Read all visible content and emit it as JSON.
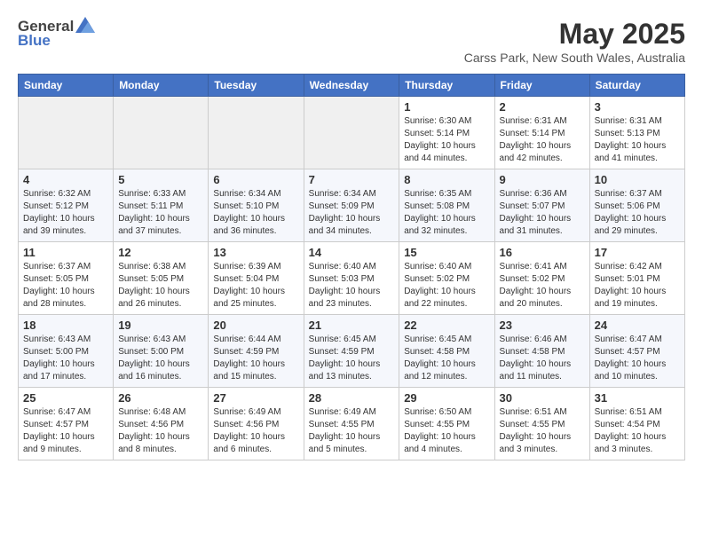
{
  "header": {
    "logo_general": "General",
    "logo_blue": "Blue",
    "month_title": "May 2025",
    "subtitle": "Carss Park, New South Wales, Australia"
  },
  "days_of_week": [
    "Sunday",
    "Monday",
    "Tuesday",
    "Wednesday",
    "Thursday",
    "Friday",
    "Saturday"
  ],
  "weeks": [
    [
      {
        "day": "",
        "info": ""
      },
      {
        "day": "",
        "info": ""
      },
      {
        "day": "",
        "info": ""
      },
      {
        "day": "",
        "info": ""
      },
      {
        "day": "1",
        "info": "Sunrise: 6:30 AM\nSunset: 5:14 PM\nDaylight: 10 hours\nand 44 minutes."
      },
      {
        "day": "2",
        "info": "Sunrise: 6:31 AM\nSunset: 5:14 PM\nDaylight: 10 hours\nand 42 minutes."
      },
      {
        "day": "3",
        "info": "Sunrise: 6:31 AM\nSunset: 5:13 PM\nDaylight: 10 hours\nand 41 minutes."
      }
    ],
    [
      {
        "day": "4",
        "info": "Sunrise: 6:32 AM\nSunset: 5:12 PM\nDaylight: 10 hours\nand 39 minutes."
      },
      {
        "day": "5",
        "info": "Sunrise: 6:33 AM\nSunset: 5:11 PM\nDaylight: 10 hours\nand 37 minutes."
      },
      {
        "day": "6",
        "info": "Sunrise: 6:34 AM\nSunset: 5:10 PM\nDaylight: 10 hours\nand 36 minutes."
      },
      {
        "day": "7",
        "info": "Sunrise: 6:34 AM\nSunset: 5:09 PM\nDaylight: 10 hours\nand 34 minutes."
      },
      {
        "day": "8",
        "info": "Sunrise: 6:35 AM\nSunset: 5:08 PM\nDaylight: 10 hours\nand 32 minutes."
      },
      {
        "day": "9",
        "info": "Sunrise: 6:36 AM\nSunset: 5:07 PM\nDaylight: 10 hours\nand 31 minutes."
      },
      {
        "day": "10",
        "info": "Sunrise: 6:37 AM\nSunset: 5:06 PM\nDaylight: 10 hours\nand 29 minutes."
      }
    ],
    [
      {
        "day": "11",
        "info": "Sunrise: 6:37 AM\nSunset: 5:05 PM\nDaylight: 10 hours\nand 28 minutes."
      },
      {
        "day": "12",
        "info": "Sunrise: 6:38 AM\nSunset: 5:05 PM\nDaylight: 10 hours\nand 26 minutes."
      },
      {
        "day": "13",
        "info": "Sunrise: 6:39 AM\nSunset: 5:04 PM\nDaylight: 10 hours\nand 25 minutes."
      },
      {
        "day": "14",
        "info": "Sunrise: 6:40 AM\nSunset: 5:03 PM\nDaylight: 10 hours\nand 23 minutes."
      },
      {
        "day": "15",
        "info": "Sunrise: 6:40 AM\nSunset: 5:02 PM\nDaylight: 10 hours\nand 22 minutes."
      },
      {
        "day": "16",
        "info": "Sunrise: 6:41 AM\nSunset: 5:02 PM\nDaylight: 10 hours\nand 20 minutes."
      },
      {
        "day": "17",
        "info": "Sunrise: 6:42 AM\nSunset: 5:01 PM\nDaylight: 10 hours\nand 19 minutes."
      }
    ],
    [
      {
        "day": "18",
        "info": "Sunrise: 6:43 AM\nSunset: 5:00 PM\nDaylight: 10 hours\nand 17 minutes."
      },
      {
        "day": "19",
        "info": "Sunrise: 6:43 AM\nSunset: 5:00 PM\nDaylight: 10 hours\nand 16 minutes."
      },
      {
        "day": "20",
        "info": "Sunrise: 6:44 AM\nSunset: 4:59 PM\nDaylight: 10 hours\nand 15 minutes."
      },
      {
        "day": "21",
        "info": "Sunrise: 6:45 AM\nSunset: 4:59 PM\nDaylight: 10 hours\nand 13 minutes."
      },
      {
        "day": "22",
        "info": "Sunrise: 6:45 AM\nSunset: 4:58 PM\nDaylight: 10 hours\nand 12 minutes."
      },
      {
        "day": "23",
        "info": "Sunrise: 6:46 AM\nSunset: 4:58 PM\nDaylight: 10 hours\nand 11 minutes."
      },
      {
        "day": "24",
        "info": "Sunrise: 6:47 AM\nSunset: 4:57 PM\nDaylight: 10 hours\nand 10 minutes."
      }
    ],
    [
      {
        "day": "25",
        "info": "Sunrise: 6:47 AM\nSunset: 4:57 PM\nDaylight: 10 hours\nand 9 minutes."
      },
      {
        "day": "26",
        "info": "Sunrise: 6:48 AM\nSunset: 4:56 PM\nDaylight: 10 hours\nand 8 minutes."
      },
      {
        "day": "27",
        "info": "Sunrise: 6:49 AM\nSunset: 4:56 PM\nDaylight: 10 hours\nand 6 minutes."
      },
      {
        "day": "28",
        "info": "Sunrise: 6:49 AM\nSunset: 4:55 PM\nDaylight: 10 hours\nand 5 minutes."
      },
      {
        "day": "29",
        "info": "Sunrise: 6:50 AM\nSunset: 4:55 PM\nDaylight: 10 hours\nand 4 minutes."
      },
      {
        "day": "30",
        "info": "Sunrise: 6:51 AM\nSunset: 4:55 PM\nDaylight: 10 hours\nand 3 minutes."
      },
      {
        "day": "31",
        "info": "Sunrise: 6:51 AM\nSunset: 4:54 PM\nDaylight: 10 hours\nand 3 minutes."
      }
    ]
  ]
}
